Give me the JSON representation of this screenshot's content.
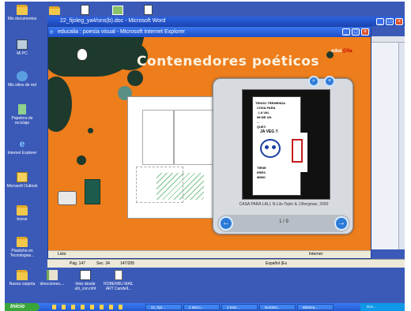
{
  "desktop_icons": [
    {
      "label": "Mis documentos",
      "icon": "folder-icon"
    },
    {
      "label": "Mi PC",
      "icon": "computer-icon"
    },
    {
      "label": "Mis sitios de red",
      "icon": "network-icon"
    },
    {
      "label": "Papelera de reciclaje",
      "icon": "recycle-bin-icon"
    },
    {
      "label": "Internet Explorer",
      "icon": "ie-icon"
    },
    {
      "label": "Microsoft Outlook",
      "icon": "outlook-icon"
    },
    {
      "label": "borrar",
      "icon": "folder-icon"
    },
    {
      "label": "Plastiche.en Tecnologias...",
      "icon": "folder-icon"
    },
    {
      "label": "Nueva carpeta",
      "icon": "folder-icon"
    },
    {
      "label": "direcciones....",
      "icon": "book-icon"
    },
    {
      "label": "links desde ulti_con.mht",
      "icon": "web-file-icon"
    },
    {
      "label": "ROBERBU MAIL ART Candell...",
      "icon": "document-icon"
    }
  ],
  "top_icons": [
    {
      "label": "",
      "icon": "folder-icon"
    },
    {
      "label": "",
      "icon": "document-icon"
    },
    {
      "label": "",
      "icon": "image-icon"
    },
    {
      "label": "",
      "icon": "document-icon"
    }
  ],
  "word_window": {
    "title": "22_fijoleg_ya4/ons(b).doc - Microsoft Word"
  },
  "ie_window": {
    "title": "educalia : poesía visual - Microsoft Internet Explorer",
    "status_left": "Listo",
    "status_right": "Internet"
  },
  "page": {
    "heading": "Contenedores poéticos",
    "logo_text": "educ",
    "logo_accent": "@lia"
  },
  "viewer": {
    "caption": "CASA PARA LALI, N.Lilo-Tején & J.Bergman, 2000",
    "counter": "1 / 9",
    "art_text": [
      "TENGO TREMENDA",
      "COSA PARA",
      "LA VAL",
      "IM ME UN",
      "...",
      "QUE!!",
      "JA VEG !!",
      "TIENE",
      "ERES",
      "MIMO"
    ]
  },
  "word_status": {
    "page": "Pág. 147",
    "section": "Sec. 34",
    "count": "147/205",
    "lang": "Español (Es"
  },
  "taskbar": {
    "start_label": "Inicio",
    "items": [
      "22_fijol...",
      "2 Micro...",
      "3 Inter...",
      "Nombre...",
      "Bitstrea...",
      "Doc..."
    ]
  },
  "colors": {
    "page_orange": "#ee7d1b",
    "splash_green": "#1d3a2d",
    "desktop_blue": "#3b5ab8",
    "viewer_button": "#2c7ad6"
  }
}
